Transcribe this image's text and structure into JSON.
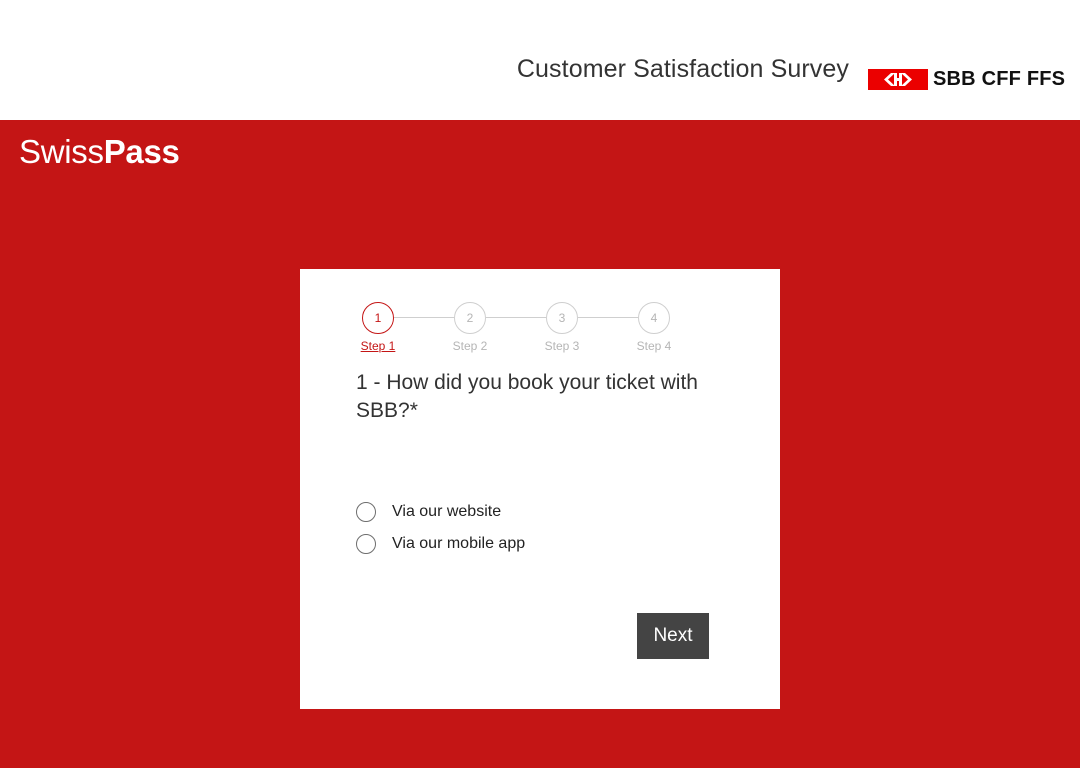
{
  "header": {
    "survey_title": "Customer Satisfaction Survey",
    "sbb_logo_text": "SBB CFF FFS",
    "logo_icon": "sbb-arrows-icon",
    "logo_color": "#eb0000"
  },
  "brand": {
    "part1": "Swiss",
    "part2": "Pass"
  },
  "colors": {
    "background_red": "#c41515",
    "button": "#444444"
  },
  "stepper": {
    "current_step": 1,
    "steps": [
      {
        "number": "1",
        "label": "Step 1",
        "active": true
      },
      {
        "number": "2",
        "label": "Step 2",
        "active": false
      },
      {
        "number": "3",
        "label": "Step 3",
        "active": false
      },
      {
        "number": "4",
        "label": "Step 4",
        "active": false
      }
    ]
  },
  "question": {
    "text": "1 - How did you book your ticket with SBB?*",
    "options": [
      {
        "label": "Via our website",
        "selected": false
      },
      {
        "label": "Via our mobile app",
        "selected": false
      }
    ]
  },
  "actions": {
    "next_label": "Next"
  }
}
